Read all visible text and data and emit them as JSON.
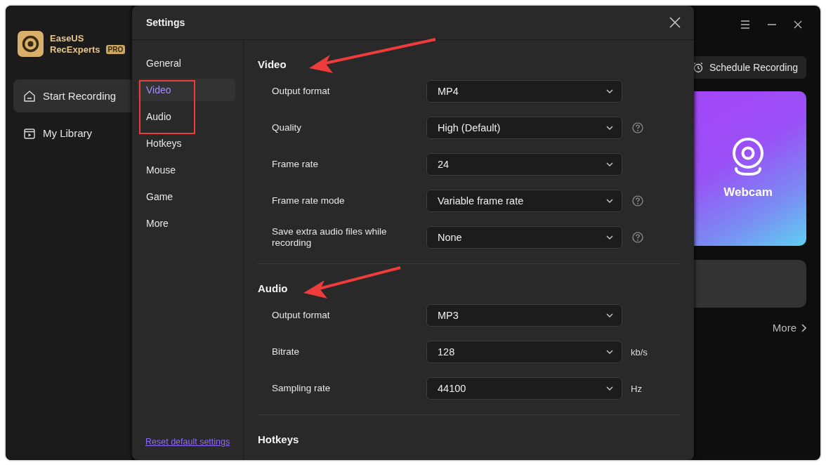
{
  "app": {
    "logo": {
      "line1": "EaseUS",
      "line2": "RecExperts",
      "badge": "PRO"
    },
    "nav": [
      {
        "label": "Start Recording",
        "selected": true
      },
      {
        "label": "My Library",
        "selected": false
      }
    ],
    "schedule_button": "Schedule Recording",
    "webcam_card": "Webcam",
    "more_link": "More"
  },
  "settings": {
    "title": "Settings",
    "nav": [
      {
        "label": "General",
        "selected": false
      },
      {
        "label": "Video",
        "selected": true
      },
      {
        "label": "Audio",
        "selected": false
      },
      {
        "label": "Hotkeys",
        "selected": false
      },
      {
        "label": "Mouse",
        "selected": false
      },
      {
        "label": "Game",
        "selected": false
      },
      {
        "label": "More",
        "selected": false
      }
    ],
    "reset_link": "Reset default settings",
    "sections": [
      {
        "title": "Video",
        "rows": [
          {
            "label": "Output format",
            "value": "MP4",
            "help": false
          },
          {
            "label": "Quality",
            "value": "High (Default)",
            "help": true
          },
          {
            "label": "Frame rate",
            "value": "24",
            "help": false
          },
          {
            "label": "Frame rate mode",
            "value": "Variable frame rate",
            "help": true
          },
          {
            "label": "Save extra audio files while recording",
            "value": "None",
            "help": true
          }
        ]
      },
      {
        "title": "Audio",
        "rows": [
          {
            "label": "Output format",
            "value": "MP3",
            "help": false
          },
          {
            "label": "Bitrate",
            "value": "128",
            "help": false,
            "unit": "kb/s"
          },
          {
            "label": "Sampling rate",
            "value": "44100",
            "help": false,
            "unit": "Hz"
          }
        ]
      },
      {
        "title": "Hotkeys"
      }
    ]
  }
}
